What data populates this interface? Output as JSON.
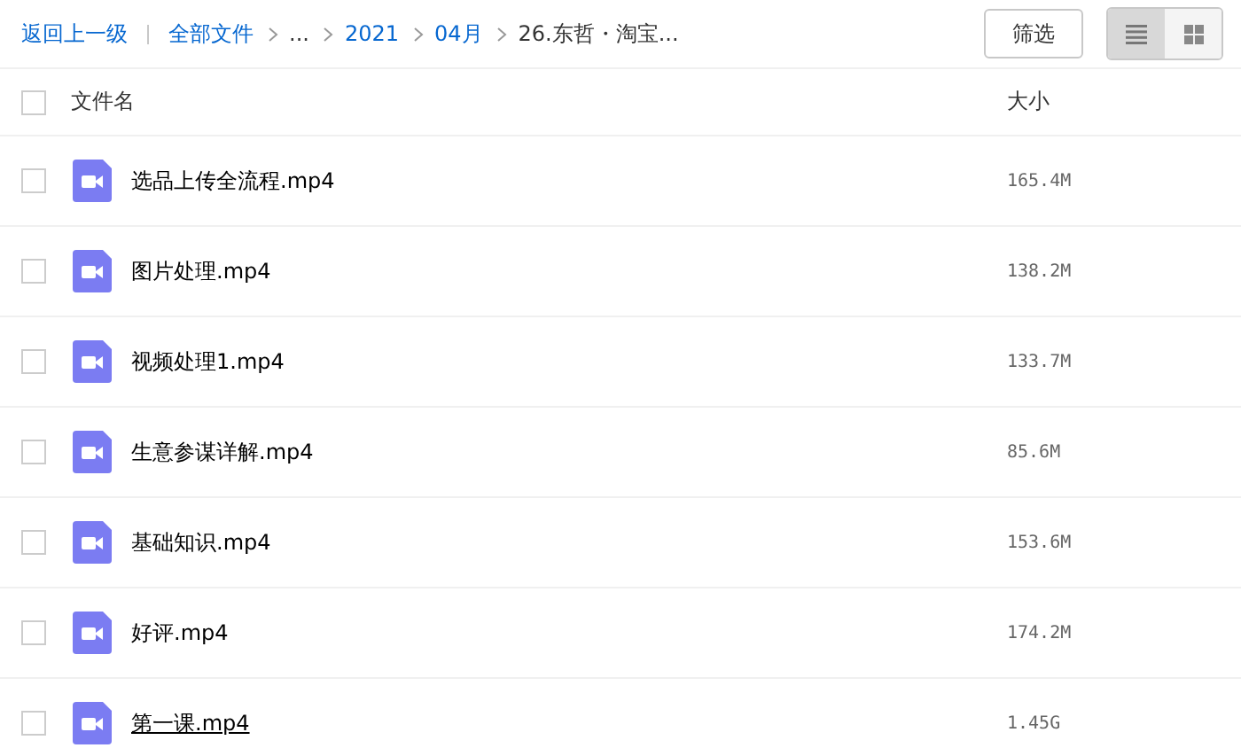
{
  "toolbar": {
    "back_link": "返回上一级",
    "breadcrumb": [
      {
        "label": "全部文件",
        "link": true
      },
      {
        "label": "...",
        "link": false
      },
      {
        "label": "2021",
        "link": true
      },
      {
        "label": "04月",
        "link": true
      },
      {
        "label": "26.东哲・淘宝...",
        "link": false
      }
    ],
    "filter_button": "筛选",
    "view_modes": [
      {
        "kind": "list",
        "selected": true
      },
      {
        "kind": "grid",
        "selected": false
      }
    ]
  },
  "table": {
    "select_all_checked": false,
    "columns": [
      "文件名",
      "大小"
    ],
    "rows": [
      {
        "name": "选品上传全流程.mp4",
        "size": "165.4M",
        "checked": false,
        "hovered": false
      },
      {
        "name": "图片处理.mp4",
        "size": "138.2M",
        "checked": false,
        "hovered": false
      },
      {
        "name": "视频处理1.mp4",
        "size": "133.7M",
        "checked": false,
        "hovered": false
      },
      {
        "name": "生意参谋详解.mp4",
        "size": "85.6M",
        "checked": false,
        "hovered": false
      },
      {
        "name": "基础知识.mp4",
        "size": "153.6M",
        "checked": false,
        "hovered": false
      },
      {
        "name": "好评.mp4",
        "size": "174.2M",
        "checked": false,
        "hovered": false
      },
      {
        "name": "第一课.mp4",
        "size": "1.45G",
        "checked": false,
        "hovered": true
      }
    ]
  }
}
